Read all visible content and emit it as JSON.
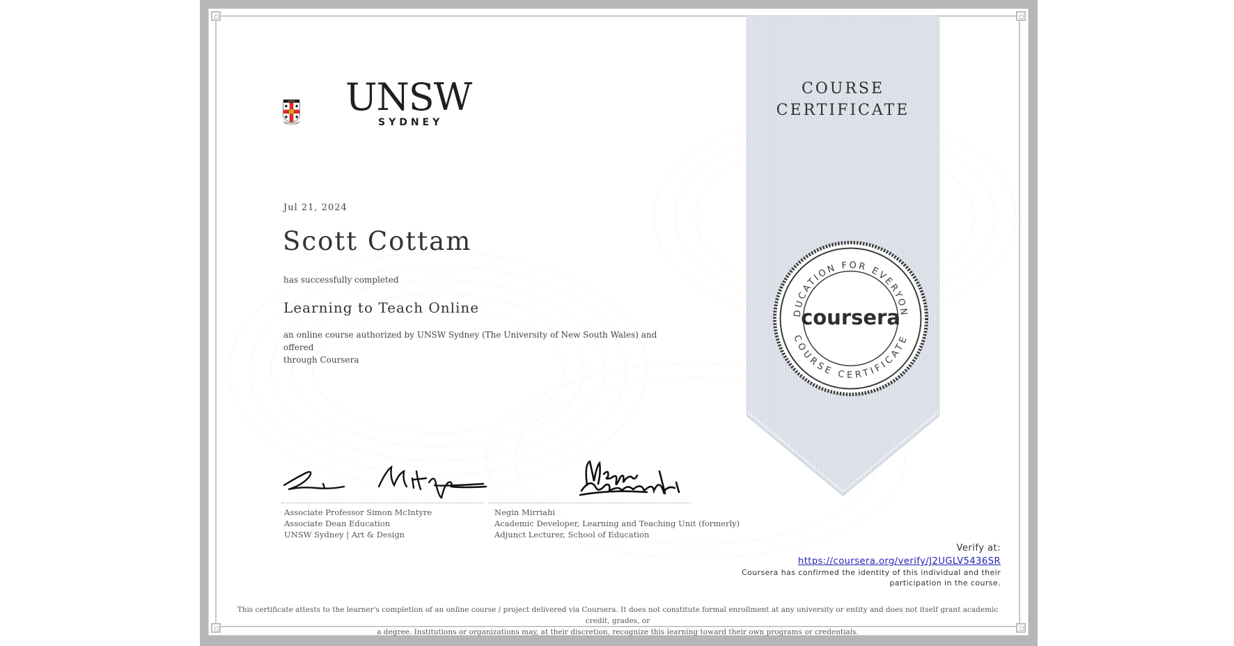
{
  "header": {
    "institution_name": "UNSW",
    "institution_sub": "SYDNEY",
    "crest_motto": "MANU ET MENTE",
    "crest_banner": "SCIENTIA"
  },
  "certificate": {
    "ribbon_line1": "COURSE",
    "ribbon_line2": "CERTIFICATE",
    "date": "Jul 21, 2024",
    "recipient_name": "Scott Cottam",
    "completed_text": "has successfully completed",
    "course_title": "Learning to Teach Online",
    "description_line1": "an online course authorized by UNSW Sydney (The University of New South Wales) and offered",
    "description_line2": "through Coursera"
  },
  "seal": {
    "brand": "coursera",
    "top_arc": "EDUCATION FOR EVERYONE",
    "bottom_arc": "COURSE CERTIFICATE"
  },
  "signatories": [
    {
      "name": "Associate Professor Simon McIntyre",
      "title": "Associate Dean Education",
      "org": "UNSW Sydney | Art & Design"
    },
    {
      "name": "Negin Mirriahi",
      "title": "Academic Developer, Learning and Teaching Unit (formerly)",
      "org": "Adjunct Lecturer, School of Education"
    }
  ],
  "verification": {
    "label": "Verify at:",
    "url": "https://coursera.org/verify/J2UGLV5436SR",
    "confirm_line1": "Coursera has confirmed the identity of this individual and their",
    "confirm_line2": "participation in the course."
  },
  "disclaimer": {
    "line1": "This certificate attests to the learner's completion of an online course / project delivered via Coursera. It does not constitute formal enrollment at any university or entity and does not itself grant academic credit, grades, or",
    "line2": "a degree. Institutions or organizations may, at their discretion, recognize this learning toward their own programs or credentials."
  },
  "colors": {
    "frame": "#b6b6b6",
    "ribbon": "#dde2ea",
    "link": "#1f1fb4",
    "crest_red": "#e0262b",
    "crest_gold": "#d9a21f"
  }
}
